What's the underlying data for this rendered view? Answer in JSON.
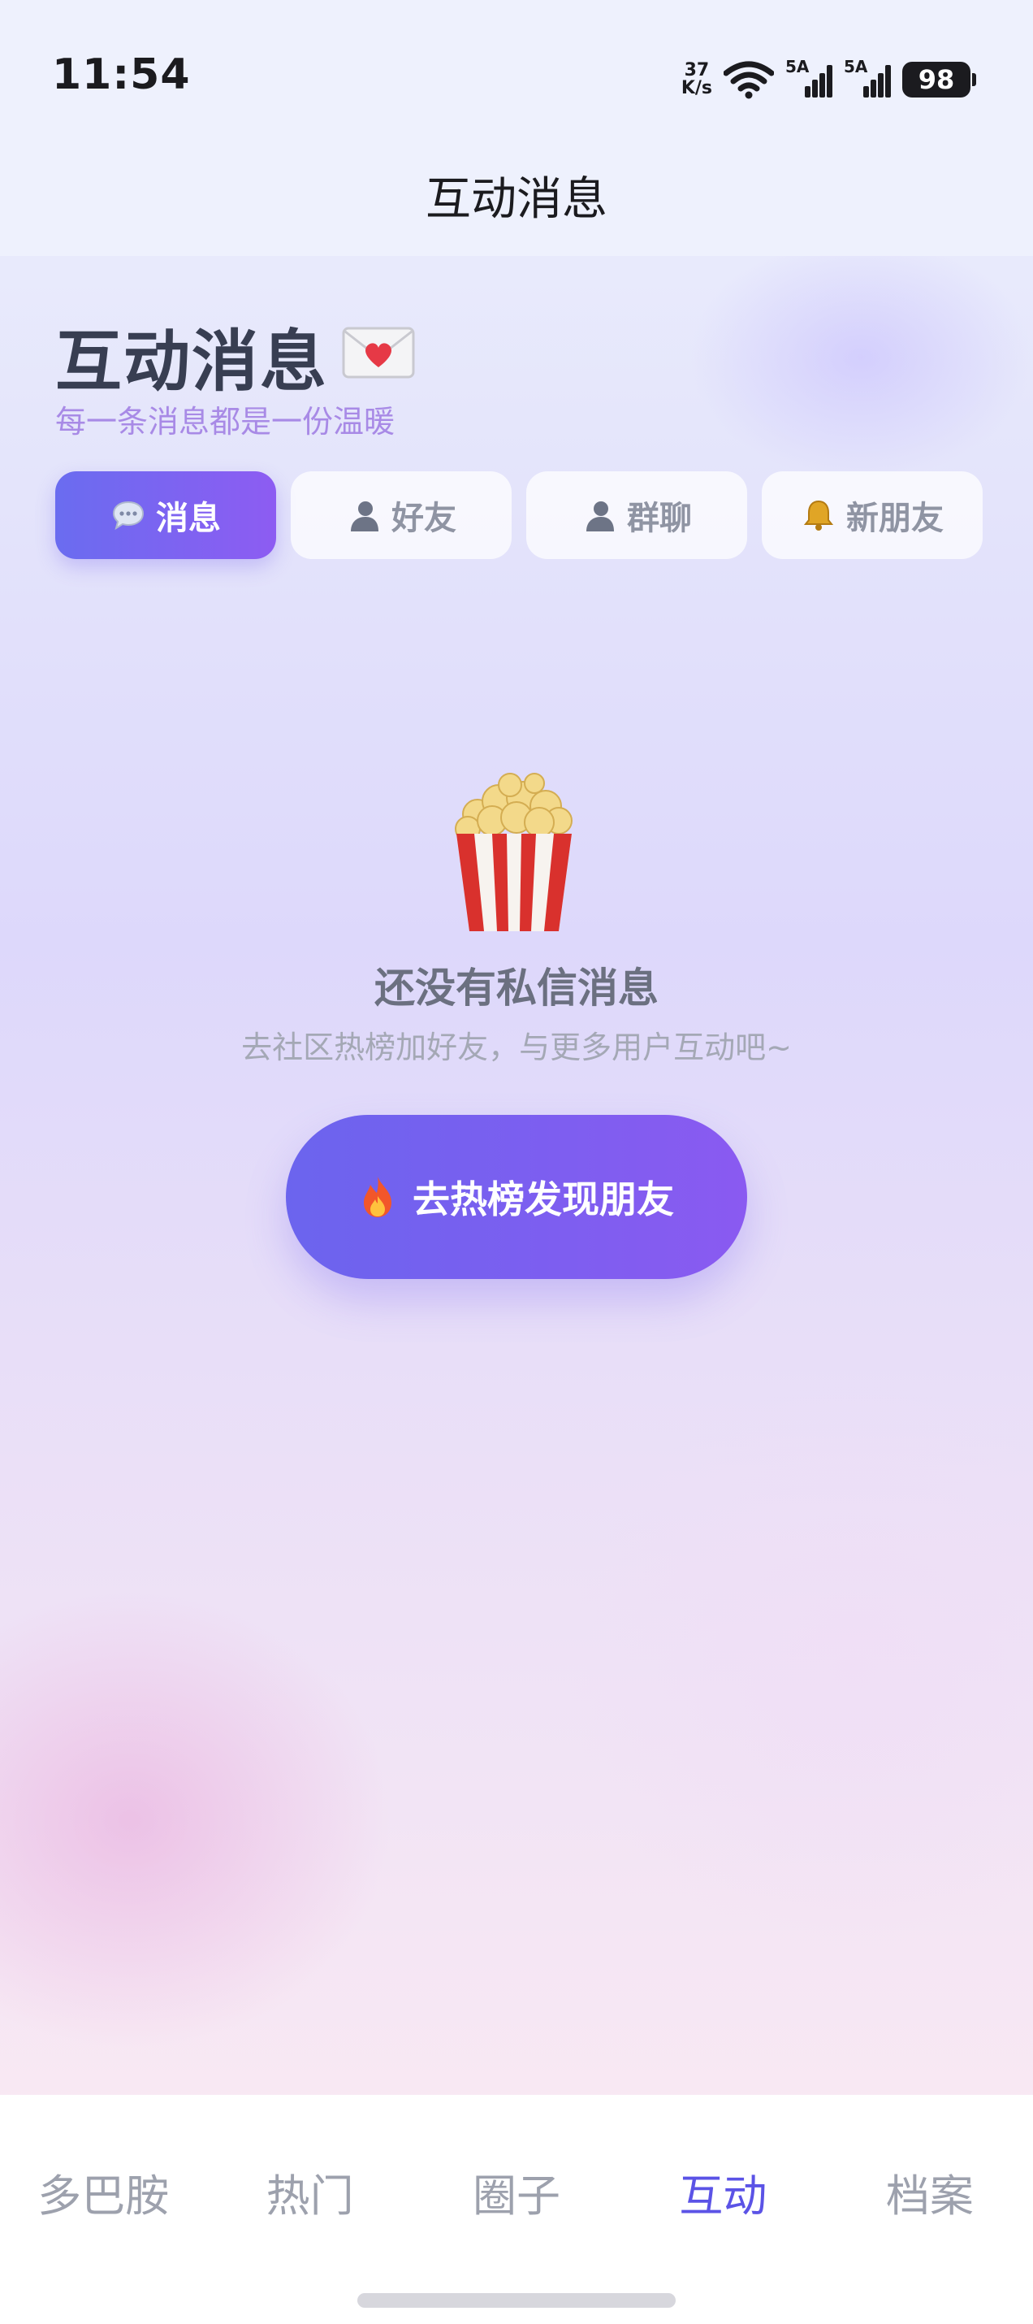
{
  "status_bar": {
    "time": "11:54",
    "net_speed_value": "37",
    "net_speed_unit": "K/s",
    "signal_1_label": "5A",
    "signal_2_label": "5A",
    "battery": "98",
    "icons": [
      "wifi-icon",
      "signal-icon",
      "signal-icon",
      "battery-icon"
    ]
  },
  "nav": {
    "title": "互动消息"
  },
  "header": {
    "title": "互动消息",
    "title_emoji": "love-letter-icon",
    "subtitle": "每一条消息都是一份温暖"
  },
  "tabs": [
    {
      "label": "消息",
      "icon": "speech-bubble-icon",
      "active": true
    },
    {
      "label": "好友",
      "icon": "person-silhouette-icon",
      "active": false
    },
    {
      "label": "群聊",
      "icon": "person-silhouette-icon",
      "active": false
    },
    {
      "label": "新朋友",
      "icon": "bell-icon",
      "active": false
    }
  ],
  "empty_state": {
    "icon": "popcorn-icon",
    "title": "还没有私信消息",
    "subtitle": "去社区热榜加好友，与更多用户互动吧~",
    "cta_icon": "fire-icon",
    "cta_label": "去热榜发现朋友"
  },
  "bottom_nav": {
    "items": [
      {
        "label": "多巴胺",
        "active": false
      },
      {
        "label": "热门",
        "active": false
      },
      {
        "label": "圈子",
        "active": false
      },
      {
        "label": "互动",
        "active": true
      },
      {
        "label": "档案",
        "active": false
      }
    ]
  },
  "colors": {
    "accent": "#6a66ee",
    "accent_end": "#8d5cf2",
    "subtitle": "#a88ae6",
    "bottom_active": "#5b53e6",
    "bottom_inactive": "#9da1ad"
  }
}
